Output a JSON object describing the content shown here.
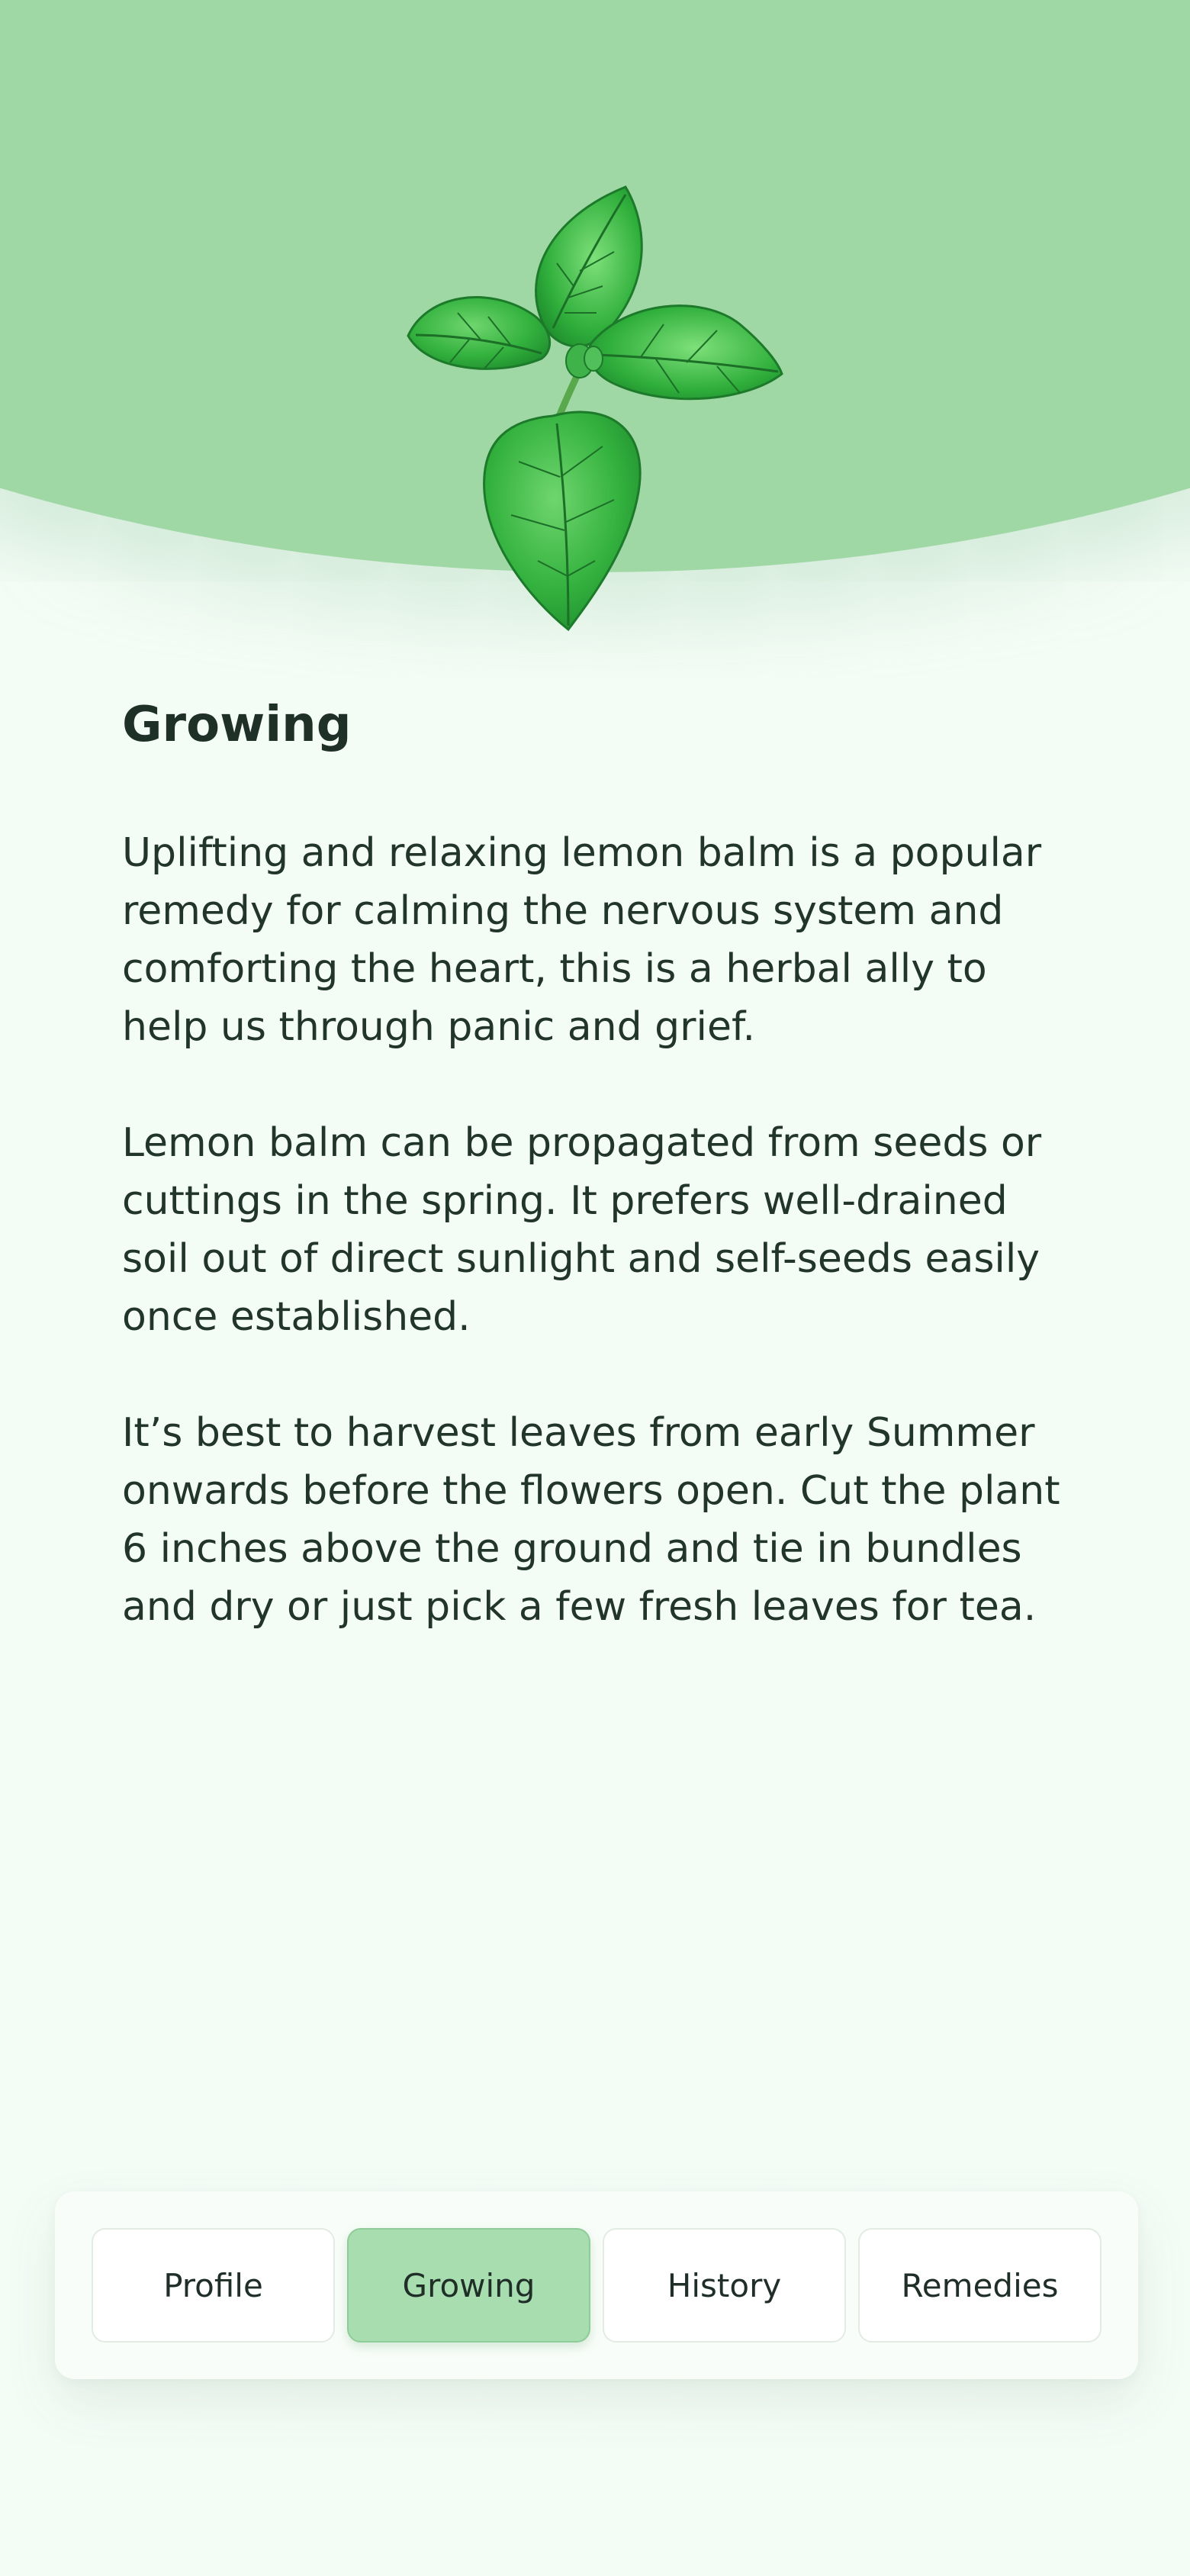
{
  "header": {
    "illustration_icon": "lemon-balm-leaves-icon"
  },
  "section": {
    "title": "Growing",
    "paragraphs": [
      "Uplifting and relaxing lemon balm is a popular remedy for calming the nervous system and comforting the heart,  this is a herbal ally to help us through panic and grief.",
      "Lemon balm can be propagated from seeds or cuttings in the spring.  It prefers well-drained soil out of direct sunlight and self-seeds easily once established.",
      "It’s best to harvest leaves from early Summer onwards before the flowers open. Cut the plant 6 inches above the ground and tie in bundles and dry or just pick a few fresh leaves for tea."
    ]
  },
  "tabs": [
    {
      "label": "Profile",
      "active": false
    },
    {
      "label": "Growing",
      "active": true
    },
    {
      "label": "History",
      "active": false
    },
    {
      "label": "Remedies",
      "active": false
    }
  ],
  "colors": {
    "background": "#f4fcf6",
    "header_green": "#9fd8a5",
    "active_tab": "#a8ddb0",
    "text": "#1f3329"
  }
}
